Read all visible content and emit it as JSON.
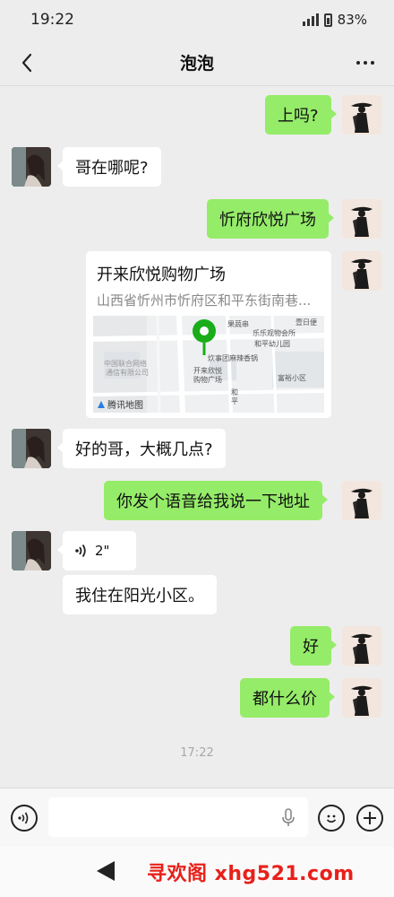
{
  "status_bar": {
    "time": "19:22",
    "battery": "83%"
  },
  "chat": {
    "title": "泡泡"
  },
  "messages": {
    "m1": "上吗?",
    "m2": "哥在哪呢?",
    "m3": "忻府欣悦广场",
    "location": {
      "name": "开来欣悦购物广场",
      "address": "山西省忻州市忻府区和平东街南巷...",
      "map_labels": [
        "果蔬串",
        "壹日便",
        "乐乐观物会所",
        "和平幼儿园",
        "中国联合网络",
        "通信有限公司",
        "炊事团麻辣香锅",
        "开来欣悦",
        "购物广场",
        "富裕小区",
        "和",
        "平"
      ],
      "provider": "腾讯地图"
    },
    "m4": "好的哥，大概几点?",
    "m5": "你发个语音给我说一下地址",
    "voice_duration": "2\"",
    "m6": "我住在阳光小区。",
    "m7": "好",
    "m8": "都什么价"
  },
  "timestamp": "17:22",
  "input": {
    "value": "",
    "placeholder": ""
  },
  "watermark": "寻欢阁 xhg521.com",
  "colors": {
    "sent_bubble": "#95ec69",
    "received_bubble": "#ffffff",
    "background": "#ededed",
    "map_pin": "#1aad19",
    "watermark": "#e8201a"
  }
}
